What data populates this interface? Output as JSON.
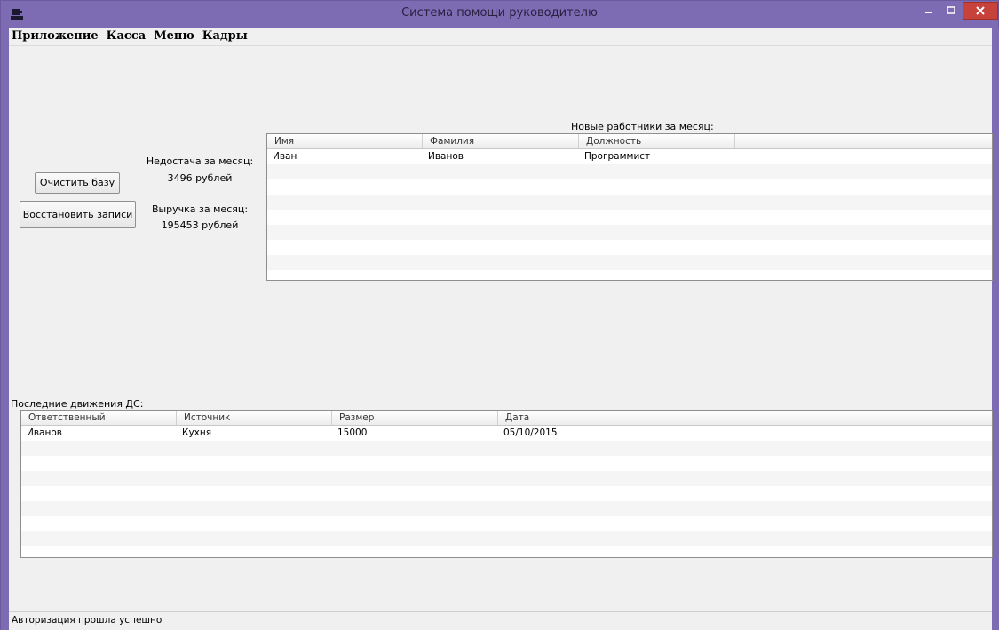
{
  "window": {
    "title": "Система помощи руководителю",
    "colors": {
      "titlebar": "#7d6bb3",
      "close_button": "#c7423a"
    }
  },
  "menu": {
    "items": [
      {
        "label": "Приложение"
      },
      {
        "label": "Касса"
      },
      {
        "label": "Меню"
      },
      {
        "label": "Кадры"
      }
    ]
  },
  "actions": {
    "clear_db": "Очистить базу",
    "restore_records": "Восстановить записи"
  },
  "stats": {
    "shortage_label": "Недостача за месяц:",
    "shortage_value": "3496 рублей",
    "revenue_label": "Выручка за месяц:",
    "revenue_value": "195453 рублей"
  },
  "new_workers": {
    "caption": "Новые работники за месяц:",
    "columns": [
      "Имя",
      "Фамилия",
      "Должность"
    ],
    "rows": [
      [
        "Иван",
        "Иванов",
        "Программист"
      ]
    ]
  },
  "cash_movements": {
    "caption": "Последние движения ДС:",
    "columns": [
      "Ответственный",
      "Источник",
      "Размер",
      "Дата"
    ],
    "rows": [
      [
        "Иванов",
        "Кухня",
        "15000",
        "05/10/2015"
      ]
    ]
  },
  "status": {
    "text": "Авторизация прошла успешно"
  },
  "icons": {
    "app": "app-icon",
    "minimize": "minimize-icon",
    "maximize": "maximize-icon",
    "close": "close-icon"
  }
}
